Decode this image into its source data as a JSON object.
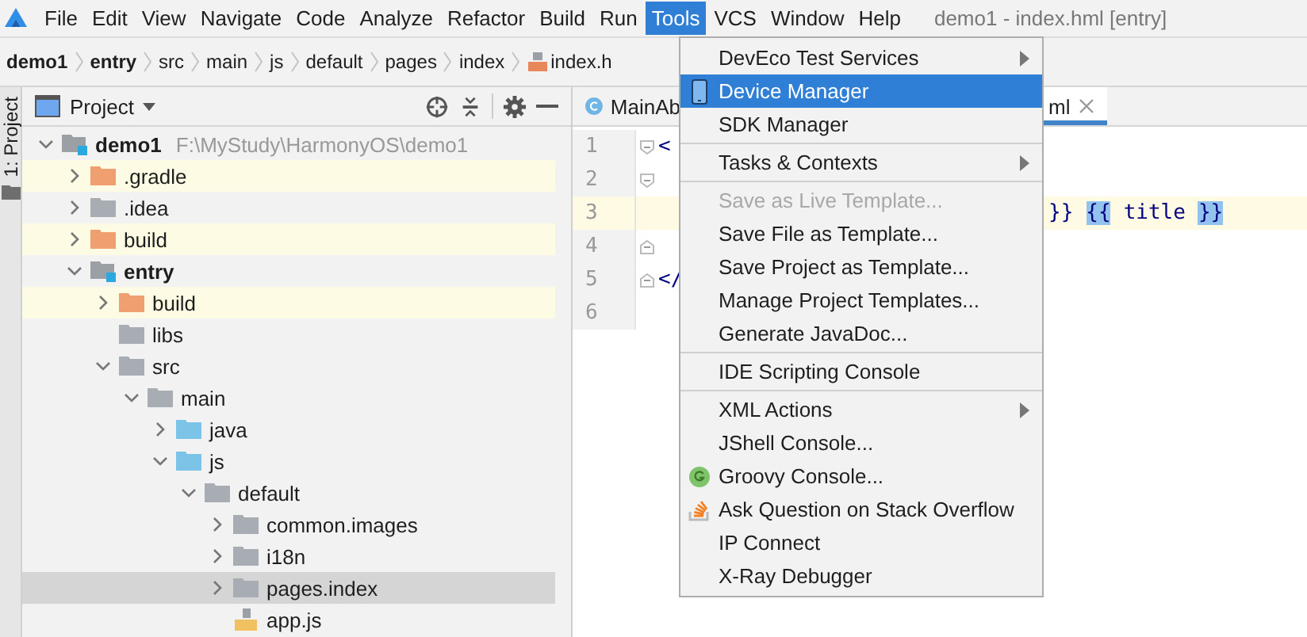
{
  "menubar": {
    "items": [
      {
        "label": "File",
        "selected": false
      },
      {
        "label": "Edit",
        "selected": false
      },
      {
        "label": "View",
        "selected": false
      },
      {
        "label": "Navigate",
        "selected": false
      },
      {
        "label": "Code",
        "selected": false
      },
      {
        "label": "Analyze",
        "selected": false
      },
      {
        "label": "Refactor",
        "selected": false
      },
      {
        "label": "Build",
        "selected": false
      },
      {
        "label": "Run",
        "selected": false
      },
      {
        "label": "Tools",
        "selected": true
      },
      {
        "label": "VCS",
        "selected": false
      },
      {
        "label": "Window",
        "selected": false
      },
      {
        "label": "Help",
        "selected": false
      }
    ],
    "title": "demo1 - index.hml [entry]"
  },
  "breadcrumb": [
    {
      "label": "demo1",
      "bold": true
    },
    {
      "label": "entry",
      "bold": true
    },
    {
      "label": "src",
      "bold": false
    },
    {
      "label": "main",
      "bold": false
    },
    {
      "label": "js",
      "bold": false
    },
    {
      "label": "default",
      "bold": false
    },
    {
      "label": "pages",
      "bold": false
    },
    {
      "label": "index",
      "bold": false
    },
    {
      "label": "index.h",
      "bold": false,
      "file": true
    }
  ],
  "side_strip": {
    "label": "1: Project"
  },
  "project_panel": {
    "title": "Project",
    "tree": [
      {
        "name": "demo1",
        "kind": "module",
        "bold": true,
        "path": "F:\\MyStudy\\HarmonyOS\\demo1",
        "expanded": true,
        "excluded": false,
        "selected": false,
        "children": [
          {
            "name": ".gradle",
            "kind": "excluded",
            "expanded": false,
            "excluded": true,
            "selected": false
          },
          {
            "name": ".idea",
            "kind": "folder",
            "expanded": false,
            "excluded": false,
            "selected": false
          },
          {
            "name": "build",
            "kind": "excluded",
            "expanded": false,
            "excluded": true,
            "selected": false
          },
          {
            "name": "entry",
            "kind": "module",
            "bold": true,
            "expanded": true,
            "excluded": false,
            "selected": false,
            "children": [
              {
                "name": "build",
                "kind": "excluded",
                "expanded": false,
                "excluded": true,
                "selected": false
              },
              {
                "name": "libs",
                "kind": "folder",
                "excluded": false,
                "selected": false
              },
              {
                "name": "src",
                "kind": "folder",
                "expanded": true,
                "excluded": false,
                "selected": false,
                "children": [
                  {
                    "name": "main",
                    "kind": "folder",
                    "expanded": true,
                    "excluded": false,
                    "selected": false,
                    "children": [
                      {
                        "name": "java",
                        "kind": "source",
                        "expanded": false,
                        "excluded": false,
                        "selected": false
                      },
                      {
                        "name": "js",
                        "kind": "source",
                        "expanded": true,
                        "excluded": false,
                        "selected": false,
                        "children": [
                          {
                            "name": "default",
                            "kind": "folder",
                            "expanded": true,
                            "excluded": false,
                            "selected": false,
                            "children": [
                              {
                                "name": "common.images",
                                "kind": "folder",
                                "expanded": false,
                                "excluded": false,
                                "selected": false
                              },
                              {
                                "name": "i18n",
                                "kind": "folder",
                                "expanded": false,
                                "excluded": false,
                                "selected": false
                              },
                              {
                                "name": "pages.index",
                                "kind": "folder",
                                "expanded": false,
                                "excluded": false,
                                "selected": true
                              },
                              {
                                "name": "app.js",
                                "kind": "js",
                                "excluded": false,
                                "selected": false
                              }
                            ]
                          }
                        ]
                      }
                    ]
                  }
                ]
              }
            ]
          }
        ]
      }
    ]
  },
  "editor": {
    "tabs": [
      {
        "label": "MainAb",
        "kind": "class",
        "selected": false,
        "closable": false
      },
      {
        "label": "ml",
        "kind": "plain",
        "selected": true,
        "closable": true
      }
    ],
    "lines": [
      {
        "number": "1",
        "kind": "opener",
        "current": false,
        "segments": [
          {
            "text": "<",
            "matched": false
          }
        ]
      },
      {
        "number": "2",
        "kind": "opener",
        "current": false
      },
      {
        "number": "3",
        "kind": "plain",
        "current": true,
        "segments": [
          {
            "text": "}}",
            "matched": false
          },
          {
            "text": "{{",
            "matched": true
          },
          {
            "text": "title",
            "matched": false
          },
          {
            "text": "}}",
            "matched": true
          }
        ]
      },
      {
        "number": "4",
        "kind": "closer",
        "current": false
      },
      {
        "number": "5",
        "kind": "closer",
        "current": false,
        "segments": [
          {
            "text": "</",
            "matched": false
          }
        ]
      },
      {
        "number": "6",
        "kind": "plain",
        "current": false
      }
    ]
  },
  "tools_menu": [
    {
      "kind": "item",
      "label": "DevEco Test Services",
      "submenu": true,
      "selected": false,
      "disabled": false
    },
    {
      "kind": "phone",
      "label": "Device Manager",
      "submenu": false,
      "selected": true,
      "disabled": false
    },
    {
      "kind": "item",
      "label": "SDK Manager",
      "submenu": false,
      "selected": false,
      "disabled": false
    },
    {
      "kind": "separator"
    },
    {
      "kind": "item",
      "label": "Tasks & Contexts",
      "submenu": true,
      "selected": false,
      "disabled": false
    },
    {
      "kind": "separator"
    },
    {
      "kind": "item",
      "label": "Save as Live Template...",
      "submenu": false,
      "selected": false,
      "disabled": true
    },
    {
      "kind": "item",
      "label": "Save File as Template...",
      "submenu": false,
      "selected": false,
      "disabled": false
    },
    {
      "kind": "item",
      "label": "Save Project as Template...",
      "submenu": false,
      "selected": false,
      "disabled": false
    },
    {
      "kind": "item",
      "label": "Manage Project Templates...",
      "submenu": false,
      "selected": false,
      "disabled": false
    },
    {
      "kind": "item",
      "label": "Generate JavaDoc...",
      "submenu": false,
      "selected": false,
      "disabled": false
    },
    {
      "kind": "separator"
    },
    {
      "kind": "item",
      "label": "IDE Scripting Console",
      "submenu": false,
      "selected": false,
      "disabled": false
    },
    {
      "kind": "separator"
    },
    {
      "kind": "item",
      "label": "XML Actions",
      "submenu": true,
      "selected": false,
      "disabled": false
    },
    {
      "kind": "item",
      "label": "JShell Console...",
      "submenu": false,
      "selected": false,
      "disabled": false
    },
    {
      "kind": "groovy",
      "label": "Groovy Console...",
      "submenu": false,
      "selected": false,
      "disabled": false
    },
    {
      "kind": "stackoverflow",
      "label": "Ask Question on Stack Overflow",
      "submenu": false,
      "selected": false,
      "disabled": false
    },
    {
      "kind": "item",
      "label": "IP Connect",
      "submenu": false,
      "selected": false,
      "disabled": false
    },
    {
      "kind": "item",
      "label": "X-Ray Debugger",
      "submenu": false,
      "selected": false,
      "disabled": false
    }
  ]
}
